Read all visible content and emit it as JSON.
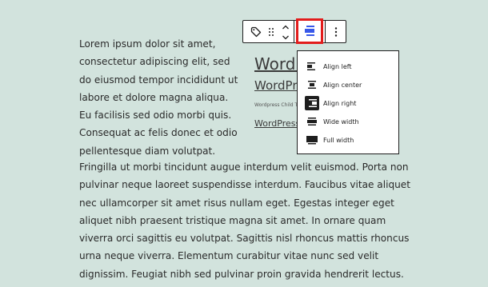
{
  "content": {
    "para_top": [
      "Lorem ipsum dolor sit amet,",
      "consectetur adipiscing elit, sed",
      "do eiusmod tempor incididunt ut",
      "labore et dolore magna aliqua.",
      "Eu facilisis sed odio morbi quis.",
      "Consequat ac felis donec et odio",
      "pellentesque diam volutpat."
    ],
    "para_bottom": [
      "Fringilla ut morbi tincidunt augue interdum velit euismod. Porta non",
      "pulvinar neque laoreet suspendisse interdum. Faucibus vitae aliquet",
      "nec ullamcorper sit amet risus nullam eget. Egestas integer eget",
      "aliquet nibh praesent tristique magna sit amet. In ornare quam",
      "viverra orci sagittis eu volutpat. Sagittis nisl rhoncus mattis rhoncus",
      "urna neque viverra. Elementum curabitur vitae nunc sed velit",
      "dignissim. Feugiat nibh sed pulvinar proin gravida hendrerit lectus."
    ]
  },
  "right_block": {
    "title": "WordPress",
    "subtitle": "WordPress",
    "small_text": "Wordpress Child Theme",
    "link": "WordPress"
  },
  "toolbar": {
    "icons": [
      "tag-icon",
      "drag-handle-icon",
      "move-up-icon",
      "move-down-icon",
      "align-icon",
      "more-options-icon"
    ],
    "active_color": "#3858e9",
    "highlight_color": "#e21c1c"
  },
  "align_menu": {
    "items": [
      {
        "label": "Align left",
        "icon": "align-left-icon"
      },
      {
        "label": "Align center",
        "icon": "align-center-icon"
      },
      {
        "label": "Align right",
        "icon": "align-right-icon",
        "selected": true
      },
      {
        "label": "Wide width",
        "icon": "wide-width-icon"
      },
      {
        "label": "Full width",
        "icon": "full-width-icon"
      }
    ]
  }
}
